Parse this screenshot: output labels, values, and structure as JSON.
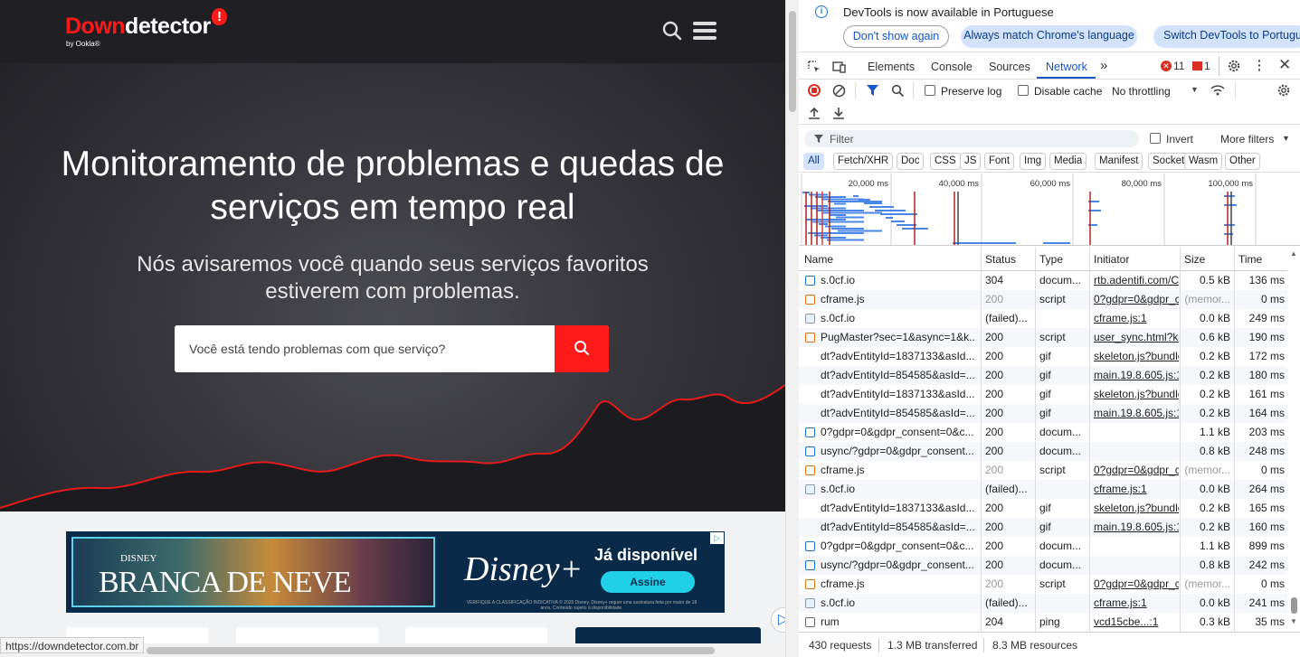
{
  "site": {
    "logo_prefix": "Down",
    "logo_rest": "detector",
    "logo_badge": "!",
    "logo_sub": "by Ookla®",
    "hero_title": "Monitoramento de problemas e quedas de serviços em tempo real",
    "hero_subtitle": "Nós avisaremos você quando seus serviços favoritos estiverem com problemas.",
    "search_placeholder": "Você está tendo problemas com que serviço?",
    "ad": {
      "small": "DISNEY",
      "title": "BRANCA DE NEVE",
      "brand": "Disney+",
      "available": "Já disponível",
      "cta": "Assine",
      "fine": "VERIFIQUE A CLASSIFICAÇÃO INDICATIVA © 2025 Disney. Disney+ requer uma assinatura feita por maior de 18 anos. Conteúdo sujeito à disponibilidade.",
      "choice": "▷"
    },
    "status_url": "https://downdetector.com.br"
  },
  "devtools": {
    "info": "DevTools is now available in Portuguese",
    "btn_dont": "Don't show again",
    "btn_always": "Always match Chrome's language",
    "btn_switch": "Switch DevTools to Portuguese",
    "tabs": [
      "Elements",
      "Console",
      "Sources",
      "Network"
    ],
    "more_tabs": "»",
    "errors": "11",
    "warnings": "1",
    "preserve_log": "Preserve log",
    "disable_cache": "Disable cache",
    "throttling": "No throttling",
    "filter_placeholder": "Filter",
    "invert": "Invert",
    "more_filters": "More filters",
    "chips": [
      "All",
      "Fetch/XHR",
      "Doc",
      "CSS",
      "JS",
      "Font",
      "Img",
      "Media",
      "Manifest",
      "Socket",
      "Wasm",
      "Other"
    ],
    "timeline_ticks": [
      "20,000 ms",
      "40,000 ms",
      "60,000 ms",
      "80,000 ms",
      "100,000 ms"
    ],
    "columns": [
      "Name",
      "Status",
      "Type",
      "Initiator",
      "Size",
      "Time"
    ],
    "rows": [
      {
        "icon": "doc",
        "name": "s.0cf.io",
        "status": "304",
        "type": "docum...",
        "initiator": "rtb.adentifi.com/C",
        "size": "0.5 kB",
        "time": "136 ms"
      },
      {
        "icon": "script",
        "name": "cframe.js",
        "status": "200",
        "type": "script",
        "initiator": "0?gdpr=0&gdpr_c",
        "size": "(memor...",
        "time": "0 ms",
        "dim": true
      },
      {
        "icon": "img",
        "name": "s.0cf.io",
        "status": "(failed)...",
        "type": "",
        "initiator": "cframe.js:1",
        "size": "0.0 kB",
        "time": "249 ms"
      },
      {
        "icon": "script",
        "name": "PugMaster?sec=1&async=1&k...",
        "status": "200",
        "type": "script",
        "initiator": "user_sync.html?kd",
        "size": "0.6 kB",
        "time": "190 ms"
      },
      {
        "icon": "",
        "name": "dt?advEntityId=1837133&asId...",
        "status": "200",
        "type": "gif",
        "initiator": "skeleton.js?bundle",
        "size": "0.2 kB",
        "time": "172 ms"
      },
      {
        "icon": "",
        "name": "dt?advEntityId=854585&asId=...",
        "status": "200",
        "type": "gif",
        "initiator": "main.19.8.605.js:1",
        "size": "0.2 kB",
        "time": "180 ms"
      },
      {
        "icon": "",
        "name": "dt?advEntityId=1837133&asId...",
        "status": "200",
        "type": "gif",
        "initiator": "skeleton.js?bundle",
        "size": "0.2 kB",
        "time": "161 ms"
      },
      {
        "icon": "",
        "name": "dt?advEntityId=854585&asId=...",
        "status": "200",
        "type": "gif",
        "initiator": "main.19.8.605.js:1",
        "size": "0.2 kB",
        "time": "164 ms"
      },
      {
        "icon": "doc",
        "name": "0?gdpr=0&gdpr_consent=0&c...",
        "status": "200",
        "type": "docum...",
        "initiator": "",
        "size": "1.1 kB",
        "time": "203 ms"
      },
      {
        "icon": "doc",
        "name": "usync/?gdpr=0&gdpr_consent...",
        "status": "200",
        "type": "docum...",
        "initiator": "",
        "size": "0.8 kB",
        "time": "248 ms"
      },
      {
        "icon": "script",
        "name": "cframe.js",
        "status": "200",
        "type": "script",
        "initiator": "0?gdpr=0&gdpr_c",
        "size": "(memor...",
        "time": "0 ms",
        "dim": true
      },
      {
        "icon": "img",
        "name": "s.0cf.io",
        "status": "(failed)...",
        "type": "",
        "initiator": "cframe.js:1",
        "size": "0.0 kB",
        "time": "264 ms"
      },
      {
        "icon": "",
        "name": "dt?advEntityId=1837133&asId...",
        "status": "200",
        "type": "gif",
        "initiator": "skeleton.js?bundle",
        "size": "0.2 kB",
        "time": "165 ms"
      },
      {
        "icon": "",
        "name": "dt?advEntityId=854585&asId=...",
        "status": "200",
        "type": "gif",
        "initiator": "main.19.8.605.js:1",
        "size": "0.2 kB",
        "time": "160 ms"
      },
      {
        "icon": "doc",
        "name": "0?gdpr=0&gdpr_consent=0&c...",
        "status": "200",
        "type": "docum...",
        "initiator": "",
        "size": "1.1 kB",
        "time": "899 ms"
      },
      {
        "icon": "doc",
        "name": "usync/?gdpr=0&gdpr_consent...",
        "status": "200",
        "type": "docum...",
        "initiator": "",
        "size": "0.8 kB",
        "time": "242 ms"
      },
      {
        "icon": "script",
        "name": "cframe.js",
        "status": "200",
        "type": "script",
        "initiator": "0?gdpr=0&gdpr_c",
        "size": "(memor...",
        "time": "0 ms",
        "dim": true
      },
      {
        "icon": "img",
        "name": "s.0cf.io",
        "status": "(failed)...",
        "type": "",
        "initiator": "cframe.js:1",
        "size": "0.0 kB",
        "time": "241 ms"
      },
      {
        "icon": "ping",
        "name": "rum",
        "status": "204",
        "type": "ping",
        "initiator": "vcd15cbe...:1",
        "size": "0.3 kB",
        "time": "35 ms"
      }
    ],
    "status_requests": "430 requests",
    "status_transferred": "1.3 MB transferred",
    "status_resources": "8.3 MB resources"
  },
  "colors": {
    "brand_red": "#ff1a1a",
    "hero_dark": "#1f1f24",
    "devtools_blue": "#1a56c8"
  }
}
